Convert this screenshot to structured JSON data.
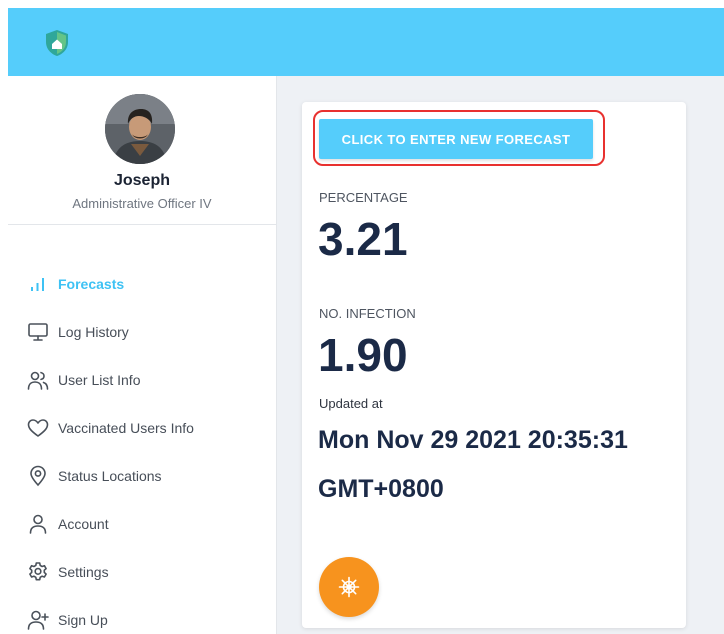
{
  "user": {
    "name": "Joseph",
    "role": "Administrative Officer IV"
  },
  "sidebar": {
    "items": [
      {
        "label": "Forecasts",
        "icon": "bar-chart-icon",
        "active": true
      },
      {
        "label": "Log History",
        "icon": "monitor-icon"
      },
      {
        "label": "User List Info",
        "icon": "users-icon"
      },
      {
        "label": "Vaccinated Users Info",
        "icon": "heart-icon"
      },
      {
        "label": "Status Locations",
        "icon": "location-pin-icon"
      },
      {
        "label": "Account",
        "icon": "person-icon"
      },
      {
        "label": "Settings",
        "icon": "gear-icon"
      },
      {
        "label": "Sign Up",
        "icon": "add-user-icon"
      }
    ]
  },
  "forecast": {
    "button_label": "CLICK TO ENTER NEW FORECAST",
    "percentage_label": "PERCENTAGE",
    "percentage_value": "3.21",
    "infection_label": "NO. INFECTION",
    "infection_value": "1.90",
    "updated_label": "Updated at",
    "updated_value": "Mon Nov 29 2021 20:35:31 GMT+0800"
  },
  "colors": {
    "header": "#55cdfb",
    "accent": "#3ec2f4",
    "fab": "#f7931e",
    "highlight": "#e8312f",
    "value_text": "#1b2a47"
  },
  "icons": {
    "logo": "shield-logo-icon",
    "fab": "ship-wheel-icon"
  }
}
